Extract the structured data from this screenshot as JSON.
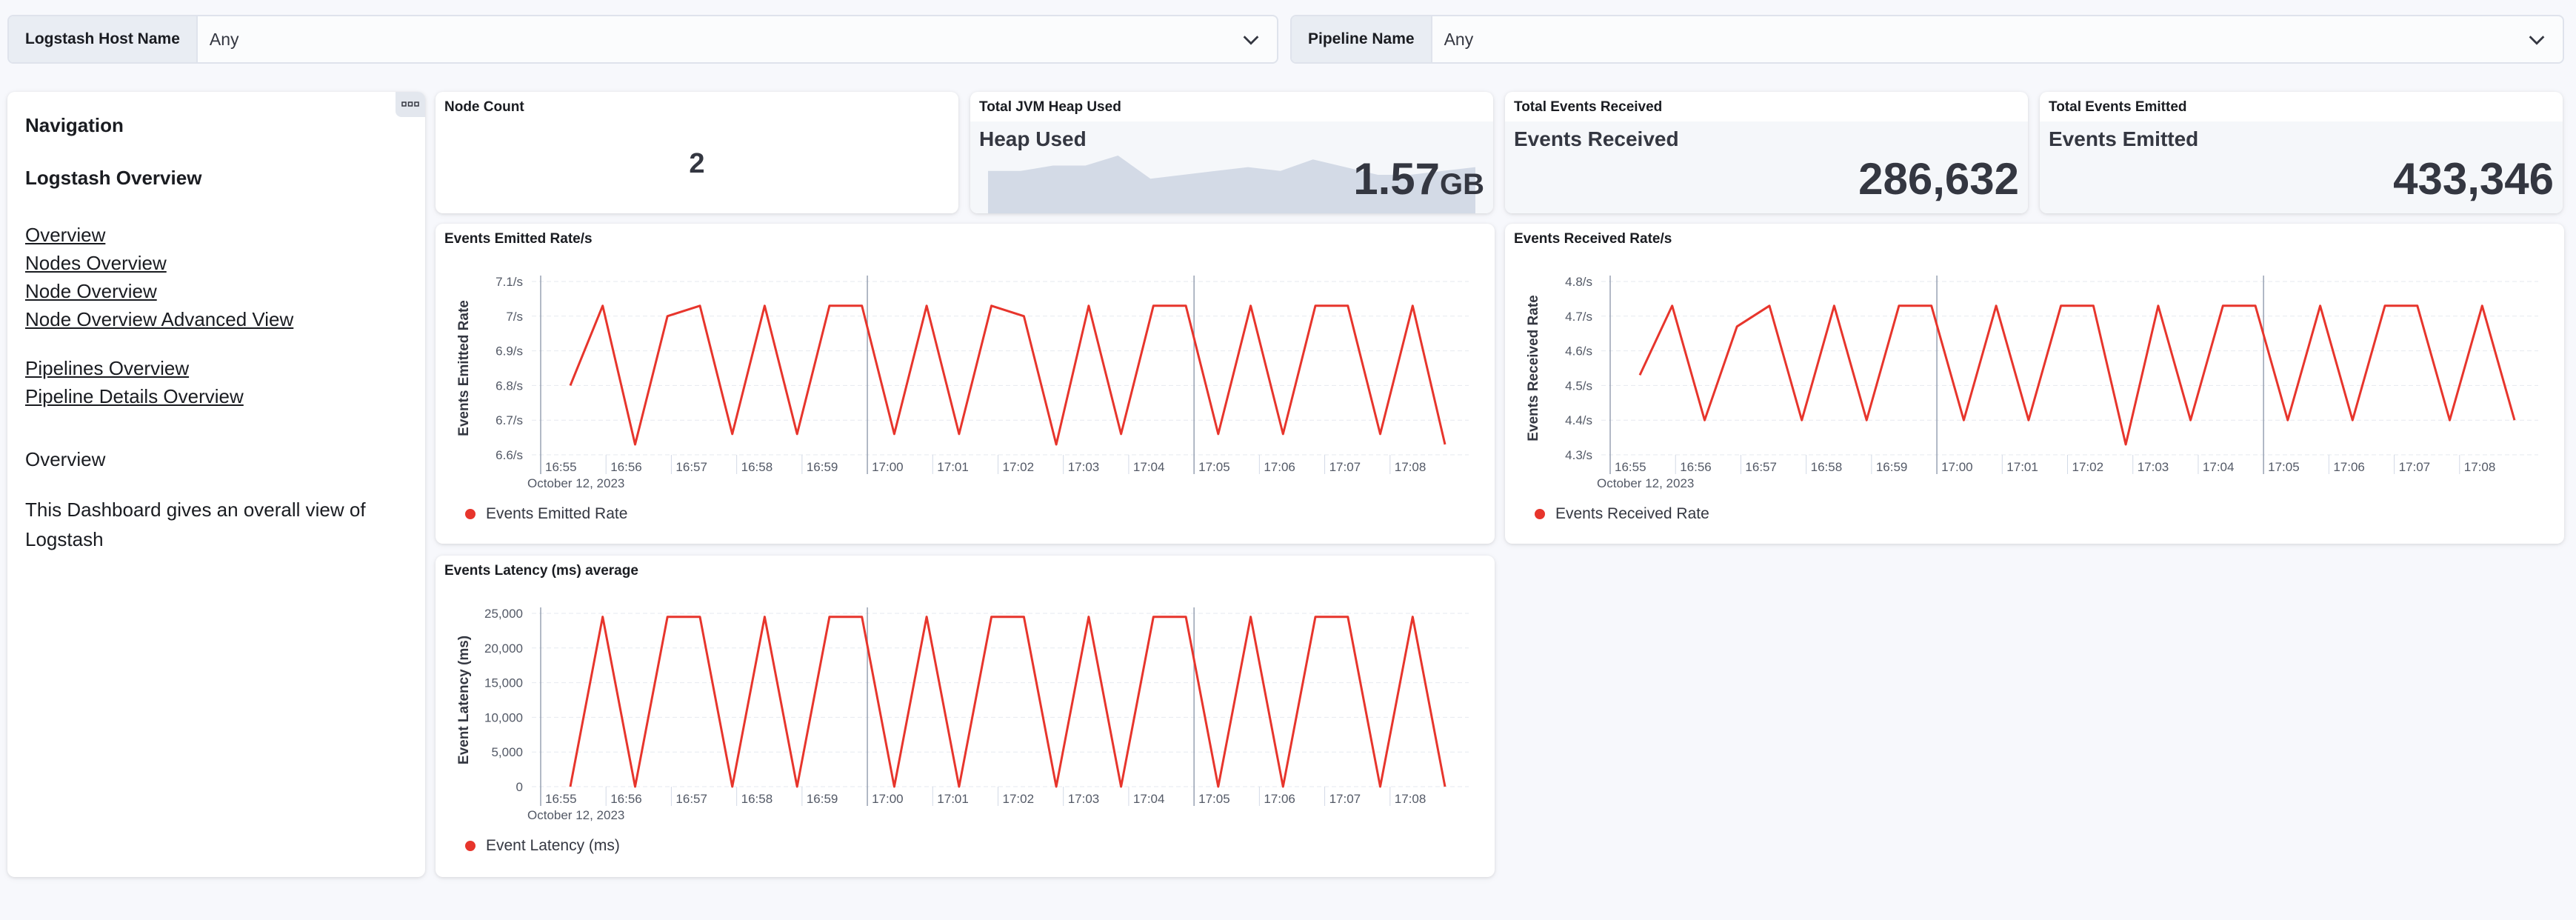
{
  "filters": [
    {
      "label": "Logstash Host Name",
      "value": "Any"
    },
    {
      "label": "Pipeline Name",
      "value": "Any"
    }
  ],
  "navigation": {
    "title": "Navigation",
    "heading": "Logstash Overview",
    "links_group1": [
      "Overview",
      "Nodes Overview",
      "Node Overview",
      "Node Overview Advanced View"
    ],
    "links_group2": [
      "Pipelines Overview",
      "Pipeline Details Overview"
    ],
    "section_title": "Overview",
    "description": "This Dashboard gives an overall view of Logstash"
  },
  "metrics": {
    "node_count": {
      "title": "Node Count",
      "value": "2"
    },
    "heap": {
      "title": "Total JVM Heap Used",
      "label": "Heap Used",
      "value": "1.57",
      "unit": "GB",
      "sparkline": [
        0.55,
        0.55,
        0.62,
        0.62,
        0.75,
        0.45,
        0.5,
        0.55,
        0.6,
        0.55,
        0.7,
        0.6,
        0.5,
        0.5,
        0.55,
        0.6
      ]
    },
    "received": {
      "title": "Total Events Received",
      "label": "Events Received",
      "value": "286,632"
    },
    "emitted": {
      "title": "Total Events Emitted",
      "label": "Events Emitted",
      "value": "433,346"
    }
  },
  "colors": {
    "series": "#e7352c",
    "accent_bg": "#f5f7fa",
    "sparkline": "#d3dae6"
  },
  "chart_data": [
    {
      "type": "line",
      "title": "Events Emitted Rate/s",
      "ylabel": "Events Emitted Rate",
      "date_label": "October 12, 2023",
      "x": [
        "16:55",
        "16:56",
        "16:57",
        "16:58",
        "16:59",
        "17:00",
        "17:01",
        "17:02",
        "17:03",
        "17:04",
        "17:05",
        "17:06",
        "17:07",
        "17:08"
      ],
      "yticks": [
        "6.6/s",
        "6.7/s",
        "6.8/s",
        "6.9/s",
        "7/s",
        "7.1/s"
      ],
      "ylim": [
        6.6,
        7.1
      ],
      "grid": true,
      "legend": "bottom-left",
      "series": [
        {
          "name": "Events Emitted Rate",
          "values": [
            6.8,
            7.03,
            6.63,
            7.0,
            7.03,
            6.66,
            7.03,
            6.66,
            7.03,
            7.03,
            6.66,
            7.03,
            6.66,
            7.03,
            7.0,
            6.63,
            7.03,
            6.66,
            7.03,
            7.03,
            6.66,
            7.03,
            6.66,
            7.03,
            7.03,
            6.66,
            7.03,
            6.63
          ]
        }
      ]
    },
    {
      "type": "line",
      "title": "Events Received Rate/s",
      "ylabel": "Events Received Rate",
      "date_label": "October 12, 2023",
      "x": [
        "16:55",
        "16:56",
        "16:57",
        "16:58",
        "16:59",
        "17:00",
        "17:01",
        "17:02",
        "17:03",
        "17:04",
        "17:05",
        "17:06",
        "17:07",
        "17:08"
      ],
      "yticks": [
        "4.3/s",
        "4.4/s",
        "4.5/s",
        "4.6/s",
        "4.7/s",
        "4.8/s"
      ],
      "ylim": [
        4.3,
        4.8
      ],
      "grid": true,
      "legend": "bottom-left",
      "series": [
        {
          "name": "Events Received Rate",
          "values": [
            4.53,
            4.73,
            4.4,
            4.67,
            4.73,
            4.4,
            4.73,
            4.4,
            4.73,
            4.73,
            4.4,
            4.73,
            4.4,
            4.73,
            4.73,
            4.33,
            4.73,
            4.4,
            4.73,
            4.73,
            4.4,
            4.73,
            4.4,
            4.73,
            4.73,
            4.4,
            4.73,
            4.4
          ]
        }
      ]
    },
    {
      "type": "line",
      "title": "Events Latency (ms) average",
      "ylabel": "Event Latency (ms)",
      "date_label": "October 12, 2023",
      "x": [
        "16:55",
        "16:56",
        "16:57",
        "16:58",
        "16:59",
        "17:00",
        "17:01",
        "17:02",
        "17:03",
        "17:04",
        "17:05",
        "17:06",
        "17:07",
        "17:08"
      ],
      "yticks": [
        "0",
        "5,000",
        "10,000",
        "15,000",
        "20,000",
        "25,000"
      ],
      "ylim": [
        0,
        25000
      ],
      "grid": true,
      "legend": "bottom-left",
      "series": [
        {
          "name": "Event Latency (ms)",
          "values": [
            0,
            24500,
            0,
            24500,
            24500,
            0,
            24500,
            0,
            24500,
            24500,
            0,
            24500,
            0,
            24500,
            24500,
            0,
            24500,
            0,
            24500,
            24500,
            0,
            24500,
            0,
            24500,
            24500,
            0,
            24500,
            0
          ]
        }
      ]
    }
  ]
}
